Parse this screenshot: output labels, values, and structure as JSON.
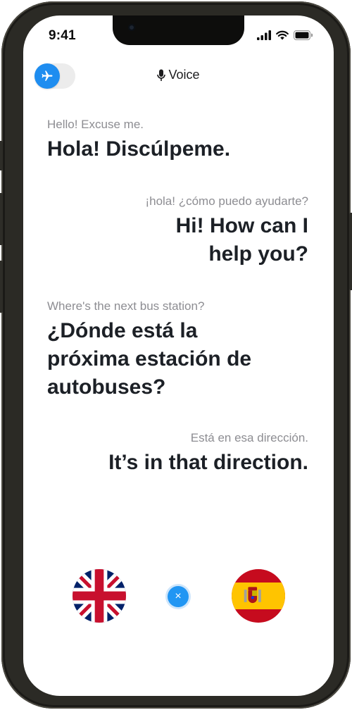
{
  "status_bar": {
    "time": "9:41"
  },
  "header": {
    "title": "Voice",
    "mic_icon": "microphone-icon"
  },
  "toggle": {
    "icon": "airplane-icon",
    "accent": "#1e8df0"
  },
  "conversation": [
    {
      "side": "left",
      "original": "Hello! Excuse me.",
      "translation": "Hola! Discúlpeme."
    },
    {
      "side": "right",
      "original": "¡hola! ¿cómo puedo ayudarte?",
      "translation": "Hi! How can I help you?"
    },
    {
      "side": "left",
      "original": "Where's the next bus station?",
      "translation": "¿Dónde está la próxima estación de autobuses?"
    },
    {
      "side": "right",
      "original": "Está en esa dirección.",
      "translation": "It’s in that direction."
    }
  ],
  "languages": {
    "left": "uk-flag-icon",
    "right": "spain-flag-icon",
    "swap_icon": "close-icon",
    "swap_glyph": "×"
  },
  "colors": {
    "accent": "#2196f3",
    "text_primary": "#1c2026",
    "text_secondary": "#8d8d92"
  }
}
